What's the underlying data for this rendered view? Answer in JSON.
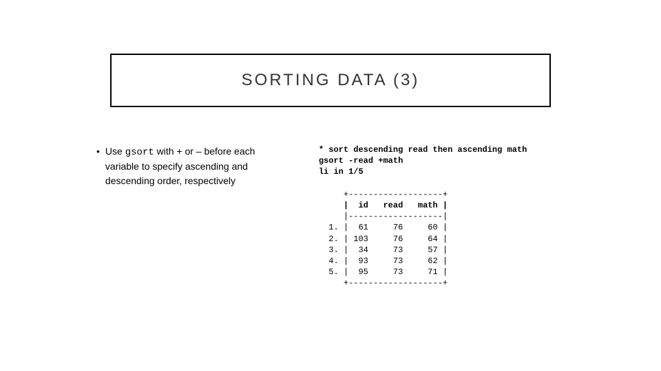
{
  "title": "SORTING DATA (3)",
  "bullet": {
    "pre": "Use ",
    "code": "gsort",
    "post": " with + or – before each variable to specify ascending and descending order, respectively"
  },
  "code": {
    "comment": "* sort descending read then ascending math",
    "cmd1": "gsort -read +math",
    "cmd2": "li in 1/5",
    "tbl_top": "     +-------------------+",
    "tbl_head": "     |  id   read   math |",
    "tbl_sep": "     |-------------------|",
    "tbl_r1": "  1. |  61     76     60 |",
    "tbl_r2": "  2. | 103     76     64 |",
    "tbl_r3": "  3. |  34     73     57 |",
    "tbl_r4": "  4. |  93     73     62 |",
    "tbl_r5": "  5. |  95     73     71 |",
    "tbl_bot": "     +-------------------+"
  },
  "chart_data": {
    "type": "table",
    "title": "SORTING DATA (3)",
    "columns": [
      "id",
      "read",
      "math"
    ],
    "rows": [
      {
        "n": 1,
        "id": 61,
        "read": 76,
        "math": 60
      },
      {
        "n": 2,
        "id": 103,
        "read": 76,
        "math": 64
      },
      {
        "n": 3,
        "id": 34,
        "read": 73,
        "math": 57
      },
      {
        "n": 4,
        "id": 93,
        "read": 73,
        "math": 62
      },
      {
        "n": 5,
        "id": 95,
        "read": 73,
        "math": 71
      }
    ],
    "command": "gsort -read +math",
    "note": "sort descending read then ascending math"
  }
}
